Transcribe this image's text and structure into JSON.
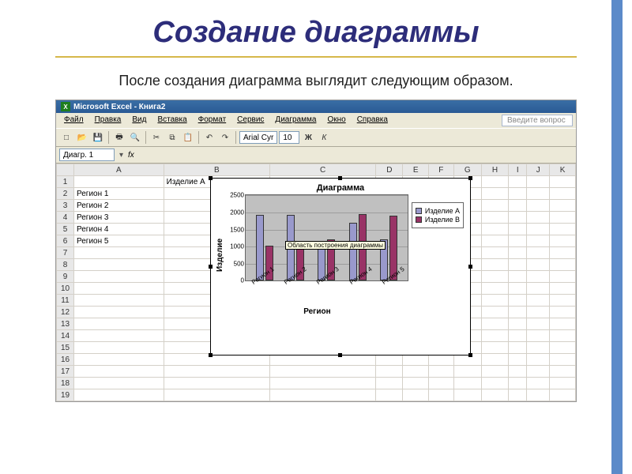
{
  "slide": {
    "title": "Создание диаграммы",
    "subtitle": "После создания диаграмма выглядит следующим образом."
  },
  "app": {
    "titlebar": "Microsoft Excel - Книга2",
    "menu": [
      "Файл",
      "Правка",
      "Вид",
      "Вставка",
      "Формат",
      "Сервис",
      "Диаграмма",
      "Окно",
      "Справка"
    ],
    "question_placeholder": "Введите вопрос",
    "font_name": "Arial Cyr",
    "font_size": "10",
    "namebox": "Диагр. 1",
    "fx_label": "fx"
  },
  "sheet": {
    "columns": [
      "A",
      "B",
      "C",
      "D",
      "E",
      "F",
      "G",
      "H",
      "I",
      "J",
      "K"
    ],
    "headers": {
      "b": "Изделие А",
      "c": "Изделие В"
    },
    "rows": [
      {
        "a": "Регион 1",
        "b": 1890,
        "c": 1000
      },
      {
        "a": "Регион 2",
        "b": 1900,
        "c": 1020
      },
      {
        "a": "Регион 3",
        "b": 1100,
        "c": 1180
      },
      {
        "a": "Регион 4",
        "b": 1660,
        "c": 1910
      },
      {
        "a": "Регион 5",
        "b": 1190,
        "c": 1880
      }
    ],
    "total_rows": 19
  },
  "chart_data": {
    "type": "bar",
    "title": "Диаграмма",
    "xlabel": "Регион",
    "ylabel": "Изделие",
    "ylim": [
      0,
      2500
    ],
    "yticks": [
      0,
      500,
      1000,
      1500,
      2000,
      2500
    ],
    "categories": [
      "Регион 1",
      "Регион 2",
      "Регион 3",
      "Регион 4",
      "Регион 5"
    ],
    "series": [
      {
        "name": "Изделие А",
        "values": [
          1890,
          1900,
          1100,
          1660,
          1190
        ]
      },
      {
        "name": "Изделие В",
        "values": [
          1000,
          1020,
          1180,
          1910,
          1880
        ]
      }
    ],
    "tooltip": "Область построения диаграммы"
  }
}
